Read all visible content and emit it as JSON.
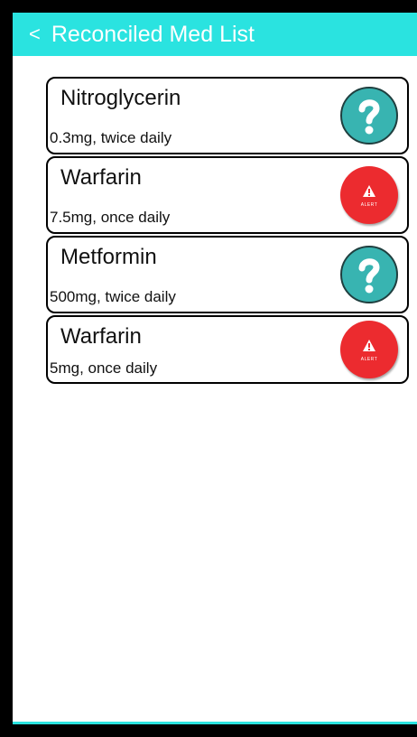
{
  "appbar": {
    "back_label": "<",
    "title": "Reconciled Med List"
  },
  "medications": [
    {
      "name": "Nitroglycerin",
      "dose": "0.3mg, twice daily",
      "status_icon": "question-icon"
    },
    {
      "name": "Warfarin",
      "dose": "7.5mg, once daily",
      "status_icon": "alert-icon",
      "alert_label": "ALERT"
    },
    {
      "name": "Metformin",
      "dose": "500mg, twice daily",
      "status_icon": "question-icon"
    },
    {
      "name": "Warfarin",
      "dose": "5mg, once daily",
      "status_icon": "alert-icon",
      "alert_label": "ALERT"
    }
  ],
  "colors": {
    "accent": "#2ae3e0",
    "question": "#38b4b1",
    "alert": "#ec2b2f"
  }
}
